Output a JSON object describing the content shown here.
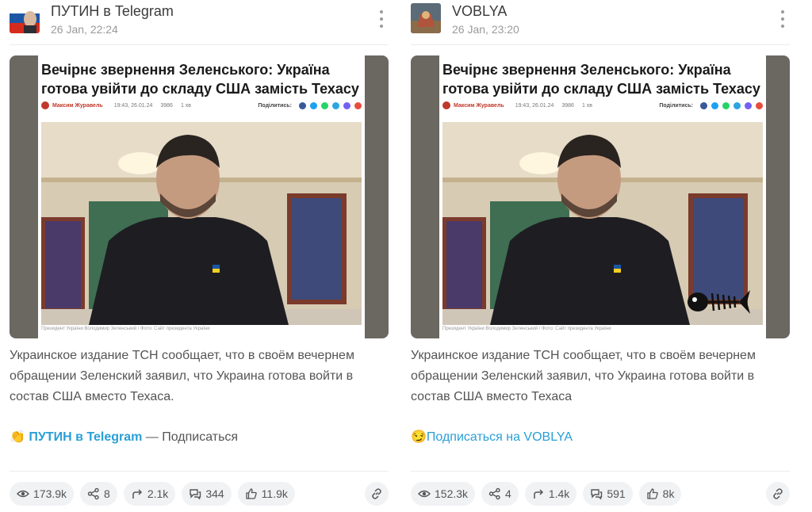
{
  "posts": [
    {
      "channel_name": "ПУТИН в Telegram",
      "date": "26 Jan, 22:24",
      "article": {
        "title": "Вечірнє звернення Зеленського: Україна готова увійти до складу США замість Техасу",
        "author": "Максим Журавель",
        "stamp": "19:43, 26.01.24",
        "views": "3986",
        "read": "1 хв",
        "share_label": "Поділитись:",
        "caption": "Президент України Володимир Зеленський / Фото: Сайт президента України"
      },
      "text": "Украинское издание ТСН сообщает, что в своём вечернем обращении Зеленский заявил, что Украина готова войти в состав США вместо Техаса.",
      "subscribe_emoji": "👏",
      "subscribe_link": "ПУТИН в Telegram",
      "subscribe_rest": " — Подписаться",
      "stats": {
        "views": "173.9k",
        "shares": "8",
        "forwards": "2.1k",
        "comments": "344",
        "likes": "11.9k"
      }
    },
    {
      "channel_name": "VOBLYA",
      "date": "26 Jan, 23:20",
      "article": {
        "title": "Вечірнє звернення Зеленського: Україна готова увійти до складу США замість Техасу",
        "author": "Максим Журавель",
        "stamp": "19:43, 26.01.24",
        "views": "3986",
        "read": "1 хв",
        "share_label": "Поділитись:",
        "caption": "Президент України Володимир Зеленський / Фото: Сайт президента України"
      },
      "text": "Украинское издание ТСН сообщает, что в своём вечернем обращении Зеленский заявил, что Украина готова войти в состав США вместо Техаса",
      "subscribe_emoji": "😏",
      "subscribe_link": "Подписаться на VOBLYA",
      "stats": {
        "views": "152.3k",
        "shares": "4",
        "forwards": "1.4k",
        "comments": "591",
        "likes": "8k"
      }
    }
  ],
  "colors": {
    "link": "#2a9fd6",
    "pill_bg": "#f1f2f4",
    "muted": "#9a9a9a"
  },
  "icons": [
    "more-vert-icon",
    "eye-icon",
    "share-icon",
    "forward-icon",
    "comments-icon",
    "thumbs-up-icon",
    "link-icon"
  ]
}
